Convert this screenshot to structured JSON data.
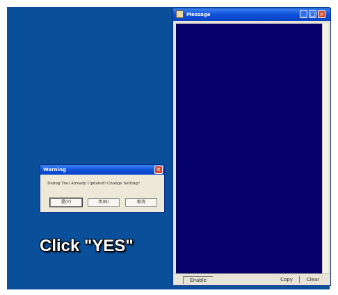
{
  "message_window": {
    "title": "Message",
    "status": {
      "enable_label": "Enable",
      "copy_label": "Copy",
      "clear_label": "Clear"
    }
  },
  "warning_dialog": {
    "title": "Warning",
    "message": "Debug Tool Already Updated! Change Setting?",
    "buttons": {
      "yes": "是(Y)",
      "no": "否(N)",
      "cancel": "取消"
    }
  },
  "caption": "Click \"YES\"",
  "colors": {
    "desktop": "#0a4f9a",
    "message_area": "#06006a",
    "titlebar": "#0f4fd9",
    "close_button": "#d8492c"
  }
}
